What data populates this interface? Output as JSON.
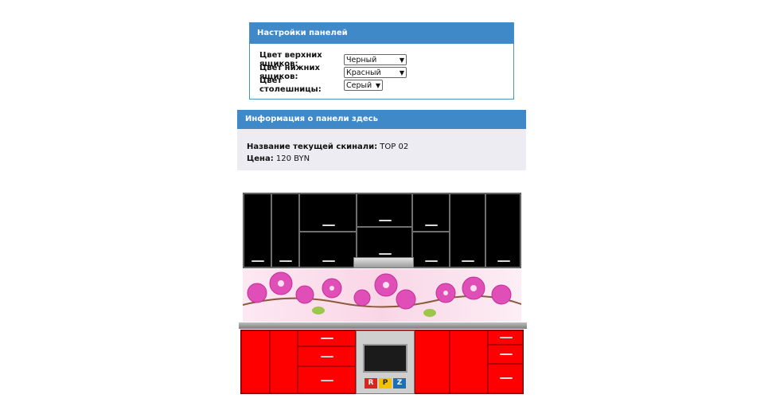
{
  "settings_panel": {
    "title": "Настройки панелей",
    "rows": [
      {
        "label": "Цвет верхних ящиков:",
        "value": "Черный"
      },
      {
        "label": "Цвет нижних ящиков:",
        "value": "Красный"
      },
      {
        "label": "Цвет столешницы:",
        "value": "Серый"
      }
    ]
  },
  "info_panel": {
    "title": "Информация о панели здесь",
    "name_label": "Название текущей скинали:",
    "name_value": "TOP 02",
    "price_label": "Цена:",
    "price_value": "120 BYN"
  },
  "preview": {
    "upper_color": "#000000",
    "lower_color": "#ff0000",
    "countertop_color": "#9e9e9e",
    "backsplash_motif": "pink-orchids",
    "oven_logo_letters": [
      "R",
      "P",
      "Z"
    ],
    "oven_logo_colors": [
      "#d7261e",
      "#f2c200",
      "#1f6fb5"
    ]
  }
}
